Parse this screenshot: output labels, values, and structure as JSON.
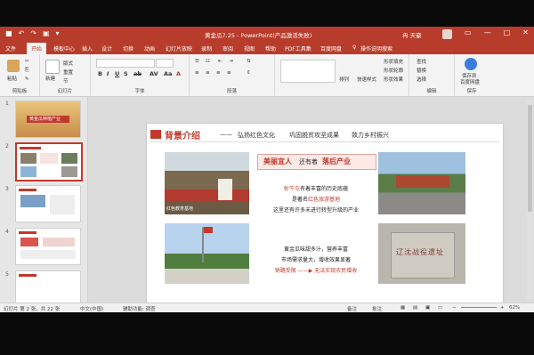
{
  "titlebar": {
    "title": "黄金瓜7.25 - PowerPoint(产品激活失败)",
    "user": "冉 天豪"
  },
  "tabs": [
    "文件",
    "开始",
    "模板中心",
    "插入",
    "设计",
    "切换",
    "动画",
    "幻灯片放映",
    "录制",
    "审阅",
    "视图",
    "帮助",
    "PDF工具集",
    "百度网盘",
    "操作说明搜索"
  ],
  "ribbon": {
    "clipboard": {
      "label": "剪贴板",
      "paste": "粘贴"
    },
    "slides": {
      "label": "幻灯片",
      "new": "新建",
      "layout": "版式",
      "reset": "重置",
      "section": "节"
    },
    "font": {
      "label": "字体"
    },
    "paragraph": {
      "label": "段落"
    },
    "drawing": {
      "arrange": "排列",
      "quickstyle": "快速样式",
      "fill": "形状填充",
      "outline": "形状轮廓",
      "effect": "形状效果"
    },
    "editing": {
      "label": "编辑",
      "find": "查找",
      "replace": "替换",
      "select": "选择"
    },
    "save": {
      "label": "保存",
      "btn1": "保存到",
      "btn2": "百度网盘"
    }
  },
  "thumbnails": [
    {
      "num": "1",
      "caption": "黄金瓜种植产业"
    },
    {
      "num": "2",
      "caption": ""
    },
    {
      "num": "3",
      "caption": ""
    },
    {
      "num": "4",
      "caption": ""
    },
    {
      "num": "5",
      "caption": ""
    }
  ],
  "slide": {
    "heading": "背景介绍",
    "dash": "——",
    "subtitle": [
      "弘扬红色文化",
      "巩固脱贫攻坚成果",
      "致力乡村振兴"
    ],
    "box_title_a": "美丽宜人",
    "box_title_b": "还有着",
    "box_title_c": "落后产业",
    "line1_red": "虻牛屯",
    "line1_rest": "有着丰富的历史底蕴",
    "line2_pre": "是著名",
    "line2_red": "红色旅游基地",
    "line3": "这里还有许多未进行转型升级的产业",
    "line4": "黄金瓜味甜多汁，营养丰富",
    "line5": "市场需求量大，增收效果显著",
    "line6_a": "销路受限",
    "line6_arrow": "——",
    "line6_b": "无法实现农民增收",
    "photo_caption": "红色教育基地",
    "stone_title": "辽沈战役遗址"
  },
  "status": {
    "slide_no": "幻灯片 第 2 张，共 22 张",
    "lang": "中文(中国)",
    "access": "辅助功能: 调查",
    "notes": "备注",
    "comments": "批注",
    "zoom": "62%"
  }
}
